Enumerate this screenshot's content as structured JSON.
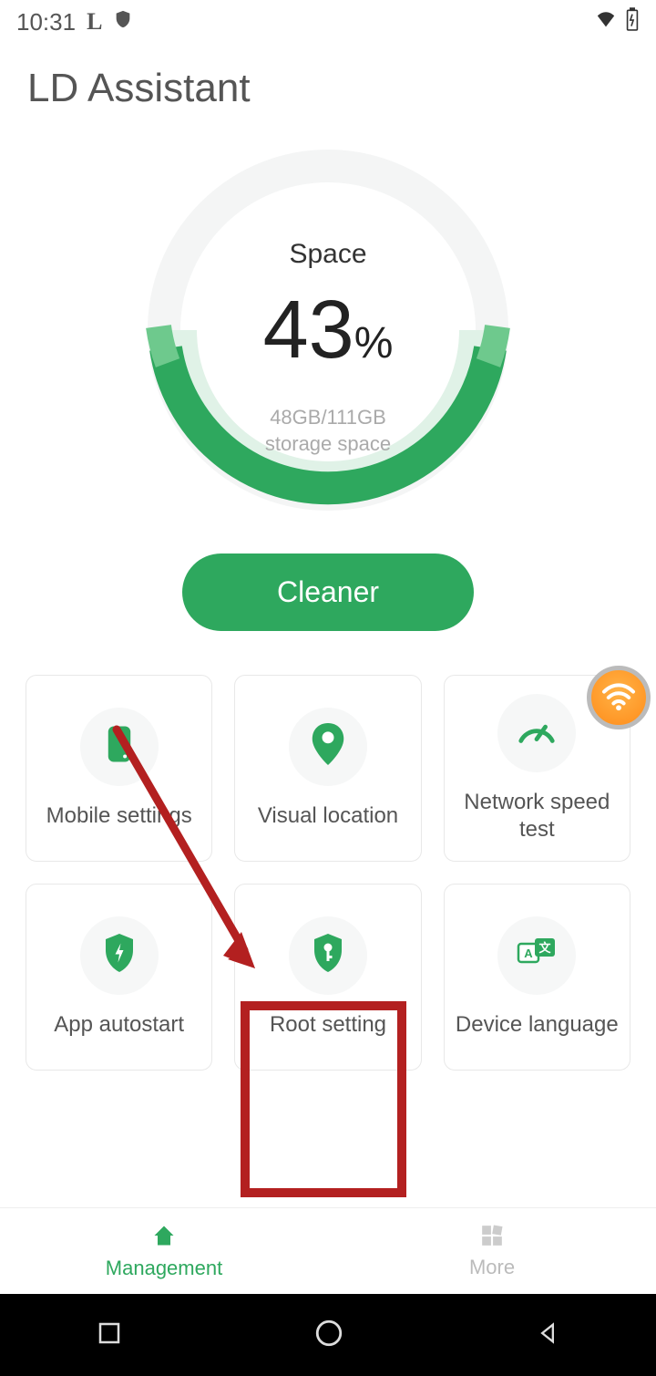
{
  "status": {
    "time": "10:31"
  },
  "app_title": "LD Assistant",
  "gauge": {
    "label": "Space",
    "value": "43",
    "percent_sign": "%",
    "sub_line1": "48GB/111GB",
    "sub_line2": "storage space"
  },
  "cleaner_button": "Cleaner",
  "cards": [
    {
      "icon": "phone-icon",
      "label": "Mobile settings"
    },
    {
      "icon": "location-pin-icon",
      "label": "Visual location"
    },
    {
      "icon": "speedometer-icon",
      "label": "Network speed test"
    },
    {
      "icon": "shield-bolt-icon",
      "label": "App autostart"
    },
    {
      "icon": "shield-key-icon",
      "label": "Root setting"
    },
    {
      "icon": "translate-icon",
      "label": "Device language"
    }
  ],
  "nav": {
    "management": "Management",
    "more": "More"
  }
}
